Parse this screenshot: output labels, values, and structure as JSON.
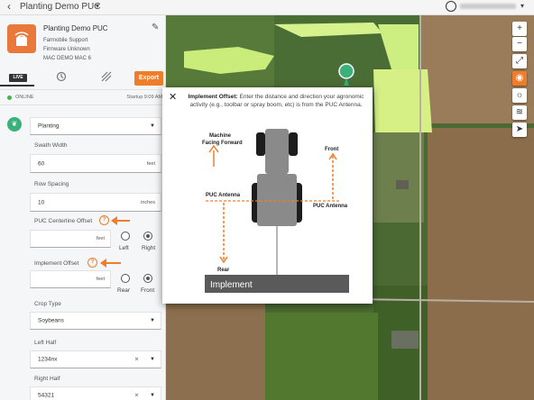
{
  "topbar": {
    "title": "Planting Demo PUC"
  },
  "device": {
    "name": "Planting Demo PUC",
    "owner": "Farmobile Support",
    "firmware": "Firmware Unknown",
    "mac": "MAC DEMO MAC 6"
  },
  "tabs": {
    "live_label": "LIVE",
    "export_label": "Export"
  },
  "status": {
    "online": "ONLINE",
    "startup": "Startup 9:09 AM"
  },
  "form": {
    "activity": "Planting",
    "swath_width_label": "Swath Width",
    "swath_width_value": "60",
    "swath_width_unit": "feet",
    "row_spacing_label": "Row Spacing",
    "row_spacing_value": "10",
    "row_spacing_unit": "inches",
    "puc_offset_label": "PUC Centerline Offset",
    "puc_offset_unit": "feet",
    "left_label": "Left",
    "right_label": "Right",
    "implement_offset_label": "Implement Offset",
    "implement_offset_unit": "feet",
    "rear_label": "Rear",
    "front_label": "Front",
    "crop_type_label": "Crop Type",
    "crop_type_value": "Soybeans",
    "left_half_label": "Left Half",
    "left_half_value": "1234nx",
    "right_half_label": "Right Half",
    "right_half_value": "54321"
  },
  "modal": {
    "title": "Implement Offset:",
    "body": "Enter the distance and direction your agronomic activity (e.g., toolbar or spray boom, etc) is from the PUC Antenna.",
    "machine_label_1": "Machine",
    "machine_label_2": "Facing Forward",
    "front_label": "Front",
    "puc_antenna_left": "PUC Antenna",
    "puc_antenna_right": "PUC Antenna",
    "rear_label": "Rear",
    "implement_label": "Implement"
  },
  "map_controls": [
    "plus-icon",
    "minus-icon",
    "fullscreen-icon",
    "globe-icon",
    "weather-icon",
    "layers-icon",
    "locate-icon"
  ],
  "colors": {
    "accent": "#f07d2a",
    "online": "#4caf50",
    "activity": "#3ab07a"
  }
}
